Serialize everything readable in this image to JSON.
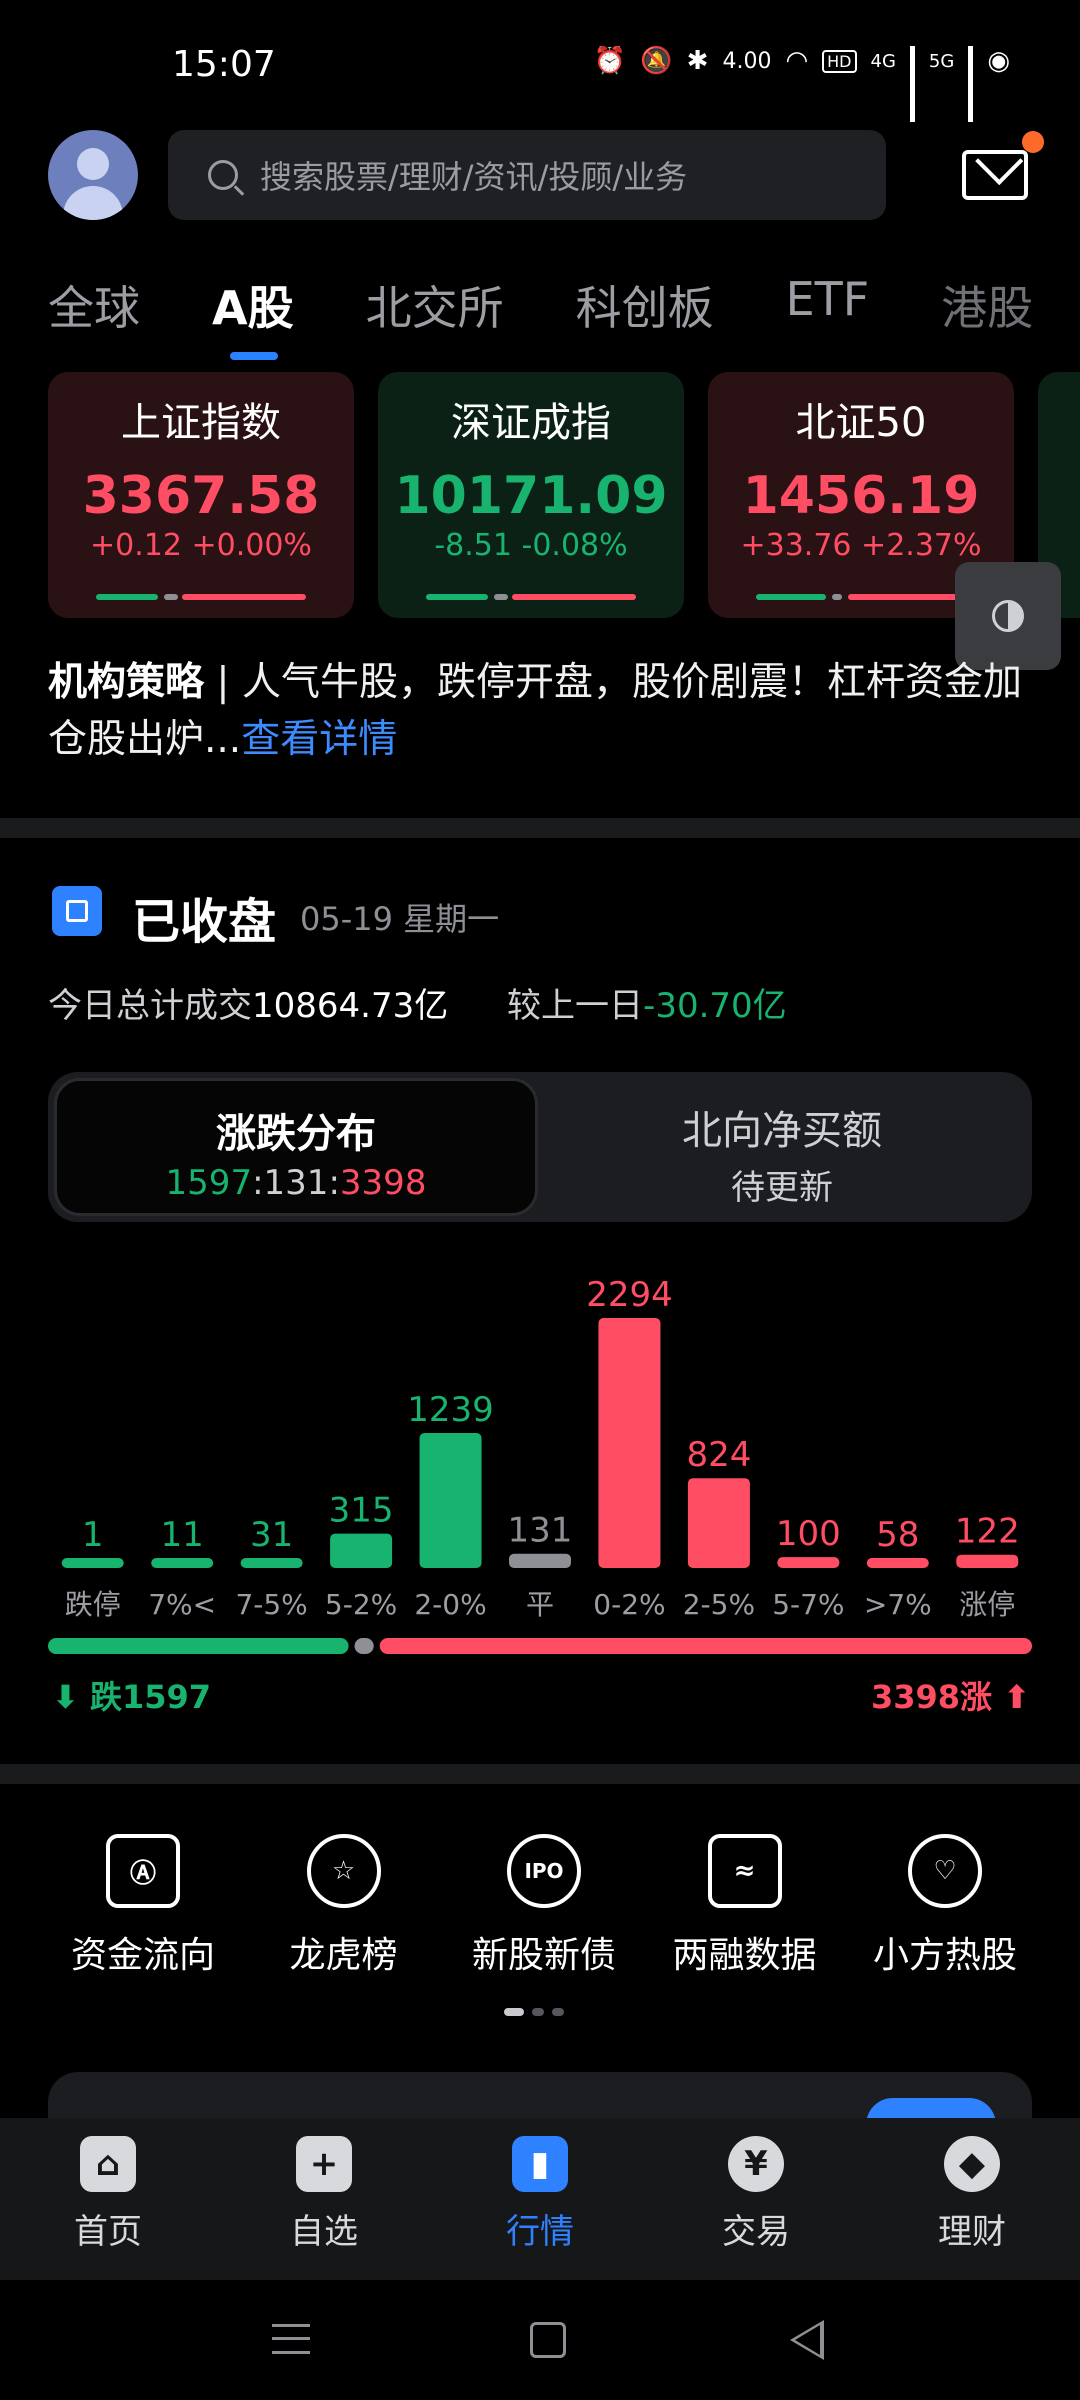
{
  "status_bar": {
    "time": "15:07",
    "network_speed": "4.00",
    "hd_label": "HD",
    "sig1": "4G",
    "sig2": "5G"
  },
  "search": {
    "placeholder": "搜索股票/理财/资讯/投顾/业务"
  },
  "market_tabs": [
    {
      "label": "全球",
      "active": false
    },
    {
      "label": "A股",
      "active": true
    },
    {
      "label": "北交所",
      "active": false
    },
    {
      "label": "科创板",
      "active": false
    },
    {
      "label": "ETF",
      "active": false
    },
    {
      "label": "港股",
      "active": false
    }
  ],
  "indices": [
    {
      "name": "上证指数",
      "value": "3367.58",
      "change": "+0.12 +0.00%",
      "trend": "up"
    },
    {
      "name": "深证成指",
      "value": "10171.09",
      "change": "-8.51 -0.08%",
      "trend": "down"
    },
    {
      "name": "北证50",
      "value": "1456.19",
      "change": "+33.76 +2.37%",
      "trend": "up"
    }
  ],
  "news": {
    "tag": "机构策略",
    "separator": " | ",
    "text": "人气牛股，跌停开盘，股价剧震！杠杆资金加仓股出炉...",
    "link": "查看详情"
  },
  "market_close": {
    "status": "已收盘",
    "date": "05-19 星期一",
    "turnover_label": "今日总计成交",
    "turnover_value": "10864.73亿",
    "compare_label": "较上一日",
    "compare_value": "-30.70亿"
  },
  "toggle": {
    "left_title": "涨跌分布",
    "ratio_down": "1597",
    "ratio_flat": "131",
    "ratio_up": "3398",
    "right_title": "北向净买额",
    "right_sub": "待更新"
  },
  "chart_data": {
    "type": "bar",
    "categories": [
      "跌停",
      "7%<",
      "7-5%",
      "5-2%",
      "2-0%",
      "平",
      "0-2%",
      "2-5%",
      "5-7%",
      ">7%",
      "涨停"
    ],
    "values": [
      1,
      11,
      31,
      315,
      1239,
      131,
      2294,
      824,
      100,
      58,
      122
    ],
    "colors": [
      "#18b36e",
      "#18b36e",
      "#18b36e",
      "#18b36e",
      "#18b36e",
      "#8e9096",
      "#ff4d63",
      "#ff4d63",
      "#ff4d63",
      "#ff4d63",
      "#ff4d63"
    ],
    "ylim": [
      0,
      2294
    ],
    "title": "",
    "xlabel": "",
    "ylabel": ""
  },
  "direction": {
    "down_label": "跌1597",
    "up_label": "3398涨",
    "down": 1597,
    "flat": 131,
    "up": 3398
  },
  "tools": [
    {
      "label": "资金流向",
      "icon": "fund-flow-icon",
      "glyph": "Ⓐ"
    },
    {
      "label": "龙虎榜",
      "icon": "dragon-tiger-icon",
      "glyph": "☆"
    },
    {
      "label": "新股新债",
      "icon": "ipo-icon",
      "glyph": "IPO"
    },
    {
      "label": "两融数据",
      "icon": "margin-data-icon",
      "glyph": "≈"
    },
    {
      "label": "小方热股",
      "icon": "hot-stock-icon",
      "glyph": "♡"
    }
  ],
  "bottom_nav": [
    {
      "label": "首页",
      "icon": "home-icon",
      "glyph": "⌂",
      "active": false
    },
    {
      "label": "自选",
      "icon": "watchlist-icon",
      "glyph": "+",
      "active": false
    },
    {
      "label": "行情",
      "icon": "market-icon",
      "glyph": "▮",
      "active": true
    },
    {
      "label": "交易",
      "icon": "trade-icon",
      "glyph": "¥",
      "active": false
    },
    {
      "label": "理财",
      "icon": "wealth-icon",
      "glyph": "◆",
      "active": false
    }
  ],
  "colors": {
    "up": "#ff4d63",
    "down": "#18b36e",
    "flat": "#8e9096",
    "accent": "#2f82ff"
  }
}
